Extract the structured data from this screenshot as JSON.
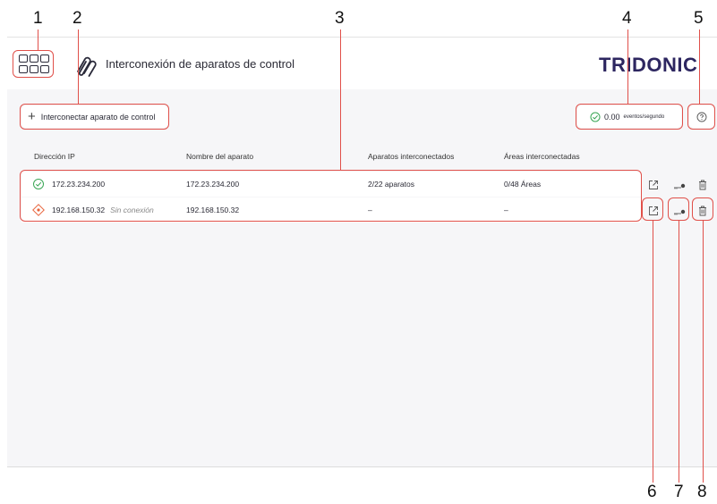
{
  "header": {
    "app_title": "Interconexión de aparatos de control",
    "brand": "TRIDONIC",
    "apps_icon": "grid-apps-icon",
    "title_icon": "paperclip-link-icon"
  },
  "toolbar": {
    "connect_label": "Interconectar aparato de control",
    "events_value": "0.00",
    "events_unit": "eventos/segundo",
    "help_icon": "help-icon"
  },
  "table": {
    "columns": [
      "Dirección IP",
      "Nombre del aparato",
      "Aparatos interconectados",
      "Áreas interconectadas"
    ],
    "rows": [
      {
        "status": "connected",
        "ip": "172.23.234.200",
        "ip_note": "",
        "name": "172.23.234.200",
        "devices": "2/22 aparatos",
        "areas": "0/48 Áreas"
      },
      {
        "status": "disconnected",
        "ip": "192.168.150.32",
        "ip_note": "Sin conexión",
        "name": "192.168.150.32",
        "devices": "–",
        "areas": "–"
      }
    ],
    "actions": [
      "open-external-icon",
      "key-icon",
      "trash-icon"
    ]
  },
  "callouts": [
    "1",
    "2",
    "3",
    "4",
    "5",
    "6",
    "7",
    "8"
  ],
  "colors": {
    "brand": "#2d2660",
    "callout": "#e0504a",
    "connected": "#3aa655",
    "disconnected": "#e8623a",
    "background": "#f6f6f8"
  }
}
